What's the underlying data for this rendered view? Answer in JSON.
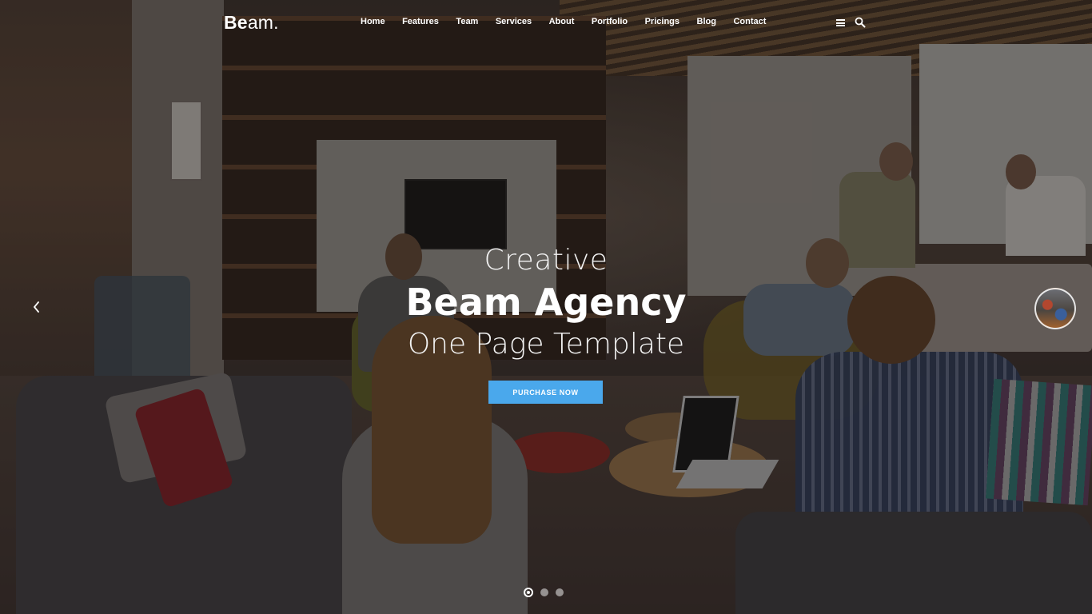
{
  "brand": {
    "logo_bold": "Be",
    "logo_rest": "am."
  },
  "nav": {
    "items": [
      {
        "label": "Home"
      },
      {
        "label": "Features"
      },
      {
        "label": "Team"
      },
      {
        "label": "Services"
      },
      {
        "label": "About"
      },
      {
        "label": "Portfolio"
      },
      {
        "label": "Pricings"
      },
      {
        "label": "Blog"
      },
      {
        "label": "Contact"
      }
    ],
    "menu_icon": "hamburger-menu-icon",
    "search_icon": "search-icon"
  },
  "hero": {
    "line1": "Creative",
    "line2": "Beam Agency",
    "line3": "One Page Template",
    "cta_label": "PURCHASE NOW",
    "cta_color": "#4aa8ec"
  },
  "slider": {
    "prev_icon": "chevron-left-icon",
    "next_thumbnail": "next-slide-thumbnail",
    "total_slides": 3,
    "active_slide": 1
  }
}
